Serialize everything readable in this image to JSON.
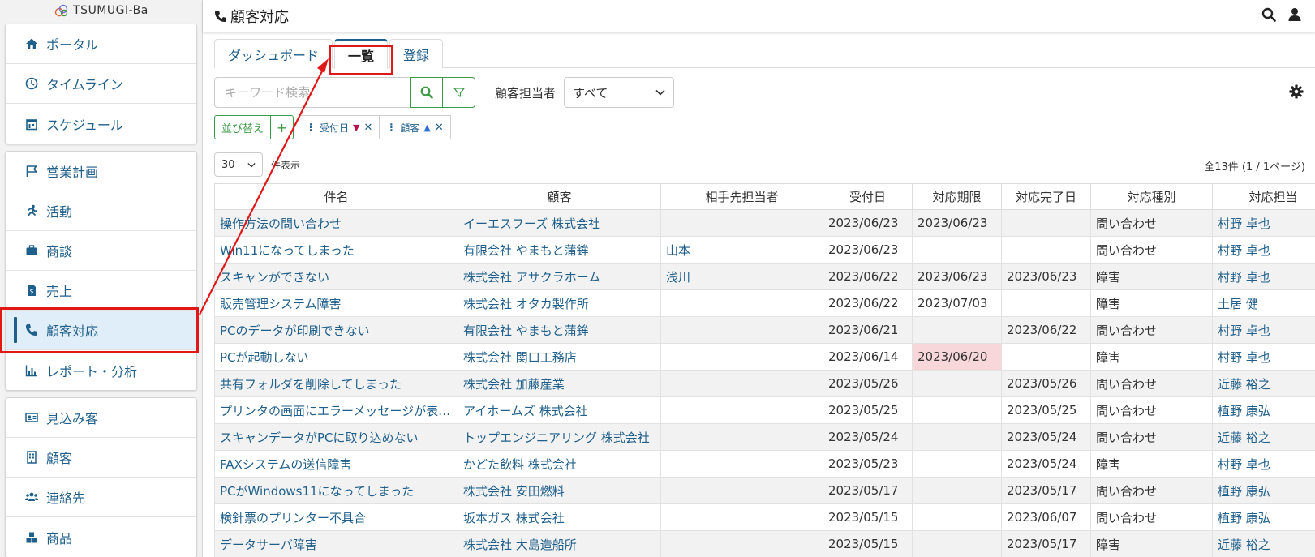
{
  "app": {
    "logo_text": "TSUMUGI-Ba",
    "page_title": "顧客対応"
  },
  "sidebar": {
    "groups": [
      [
        {
          "label": "ポータル",
          "icon": "home-icon"
        },
        {
          "label": "タイムライン",
          "icon": "clock-icon"
        },
        {
          "label": "スケジュール",
          "icon": "calendar-icon"
        }
      ],
      [
        {
          "label": "営業計画",
          "icon": "flag-icon"
        },
        {
          "label": "活動",
          "icon": "running-icon"
        },
        {
          "label": "商談",
          "icon": "briefcase-icon"
        },
        {
          "label": "売上",
          "icon": "invoice-icon"
        },
        {
          "label": "顧客対応",
          "icon": "phone-icon",
          "active": true
        },
        {
          "label": "レポート・分析",
          "icon": "chart-icon"
        }
      ],
      [
        {
          "label": "見込み客",
          "icon": "id-card-icon"
        },
        {
          "label": "顧客",
          "icon": "building-icon"
        },
        {
          "label": "連絡先",
          "icon": "users-icon"
        },
        {
          "label": "商品",
          "icon": "boxes-icon"
        }
      ]
    ]
  },
  "tabs": [
    {
      "label": "ダッシュボード"
    },
    {
      "label": "一覧",
      "active": true
    },
    {
      "label": "登録"
    }
  ],
  "search": {
    "placeholder": "キーワード検索"
  },
  "rep_filter": {
    "label": "顧客担当者",
    "value": "すべて"
  },
  "sort": {
    "button_label": "並び替え",
    "add_label": "+",
    "chips": [
      {
        "label": "受付日",
        "direction": "▼"
      },
      {
        "label": "顧客",
        "direction": "▲"
      }
    ]
  },
  "paging": {
    "per_page": "30",
    "per_page_label": "件表示",
    "count_text": "全13件 (1 / 1ページ)"
  },
  "table": {
    "headers": [
      "件名",
      "顧客",
      "相手先担当者",
      "受付日",
      "対応期限",
      "対応完了日",
      "対応種別",
      "対応担当"
    ],
    "rows": [
      [
        "操作方法の問い合わせ",
        "イーエスフーズ 株式会社",
        "",
        "2023/06/23",
        "2023/06/23",
        "",
        "問い合わせ",
        "村野 卓也"
      ],
      [
        "Win11になってしまった",
        "有限会社 やまもと蒲鉾",
        "山本",
        "2023/06/23",
        "",
        "",
        "問い合わせ",
        "村野 卓也"
      ],
      [
        "スキャンができない",
        "株式会社 アサクラホーム",
        "浅川",
        "2023/06/22",
        "2023/06/23",
        "2023/06/23",
        "障害",
        "村野 卓也"
      ],
      [
        "販売管理システム障害",
        "株式会社 オタカ製作所",
        "",
        "2023/06/22",
        "2023/07/03",
        "",
        "障害",
        "土居 健"
      ],
      [
        "PCのデータが印刷できない",
        "有限会社 やまもと蒲鉾",
        "",
        "2023/06/21",
        "",
        "2023/06/22",
        "問い合わせ",
        "村野 卓也"
      ],
      [
        "PCが起動しない",
        "株式会社 関口工務店",
        "",
        "2023/06/14",
        "2023/06/20",
        "",
        "障害",
        "村野 卓也"
      ],
      [
        "共有フォルダを削除してしまった",
        "株式会社 加藤産業",
        "",
        "2023/05/26",
        "",
        "2023/05/26",
        "問い合わせ",
        "近藤 裕之"
      ],
      [
        "プリンタの画面にエラーメッセージが表示される",
        "アイホームズ 株式会社",
        "",
        "2023/05/25",
        "",
        "2023/05/25",
        "問い合わせ",
        "植野 康弘"
      ],
      [
        "スキャンデータがPCに取り込めない",
        "トップエンジニアリング 株式会社",
        "",
        "2023/05/24",
        "",
        "2023/05/24",
        "問い合わせ",
        "近藤 裕之"
      ],
      [
        "FAXシステムの送信障害",
        "かどた飲料 株式会社",
        "",
        "2023/05/23",
        "",
        "2023/05/24",
        "障害",
        "村野 卓也"
      ],
      [
        "PCがWindows11になってしまった",
        "株式会社 安田燃料",
        "",
        "2023/05/17",
        "",
        "2023/05/17",
        "問い合わせ",
        "植野 康弘"
      ],
      [
        "検針票のプリンター不具合",
        "坂本ガス 株式会社",
        "",
        "2023/05/15",
        "",
        "2023/06/07",
        "問い合わせ",
        "植野 康弘"
      ],
      [
        "データサーバ障害",
        "株式会社 大島造船所",
        "",
        "2023/05/15",
        "",
        "2023/05/17",
        "障害",
        "近藤 裕之"
      ]
    ],
    "overdue_cell": {
      "row": 5,
      "col": 4
    }
  },
  "colors": {
    "link": "#1f5f8b",
    "accent_green": "#3c9a47",
    "annotation_red": "#e01818",
    "overdue_bg": "#f8d7da"
  }
}
